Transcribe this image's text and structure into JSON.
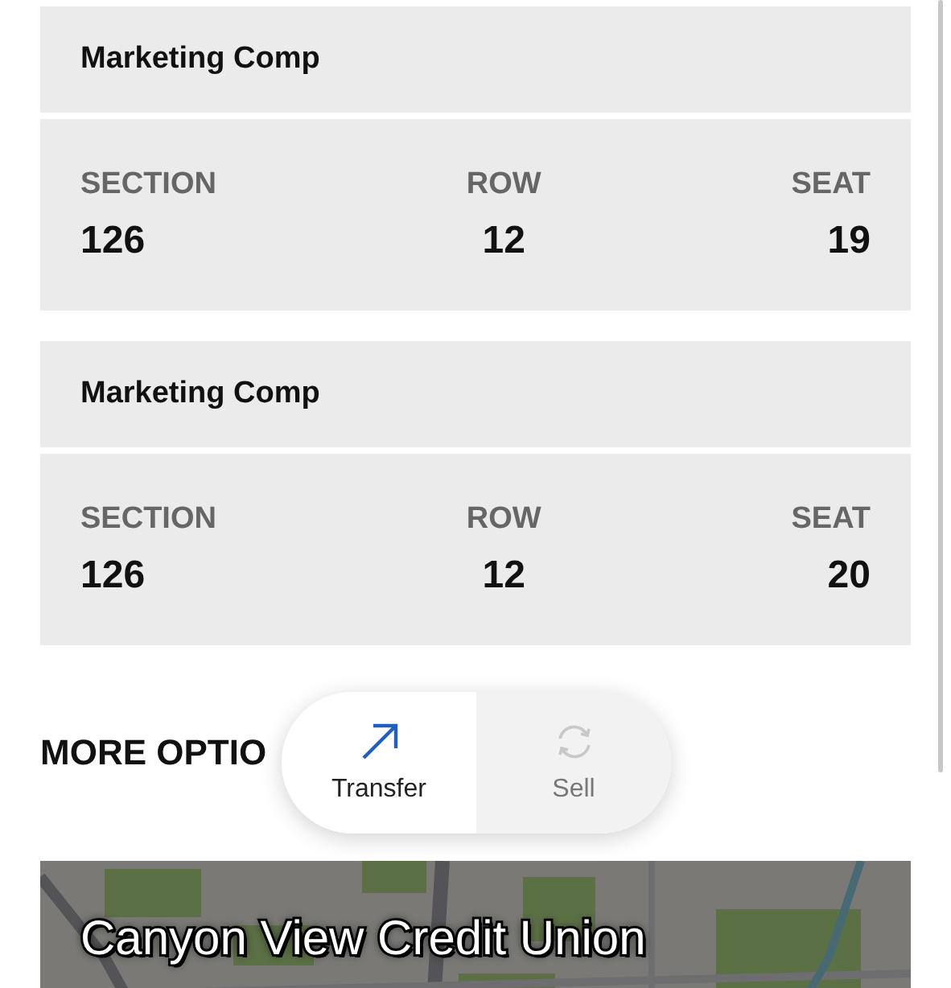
{
  "tickets": [
    {
      "title": "Marketing Comp",
      "fields": [
        {
          "label": "SECTION",
          "value": "126"
        },
        {
          "label": "ROW",
          "value": "12"
        },
        {
          "label": "SEAT",
          "value": "19"
        }
      ]
    },
    {
      "title": "Marketing Comp",
      "fields": [
        {
          "label": "SECTION",
          "value": "126"
        },
        {
          "label": "ROW",
          "value": "12"
        },
        {
          "label": "SEAT",
          "value": "20"
        }
      ]
    }
  ],
  "more_options": {
    "heading": "MORE OPTIO"
  },
  "actions": [
    {
      "kind": "transfer",
      "label": "Transfer",
      "disabled": false
    },
    {
      "kind": "sell",
      "label": "Sell",
      "disabled": true
    }
  ],
  "venue": {
    "name": "Canyon View Credit Union"
  }
}
